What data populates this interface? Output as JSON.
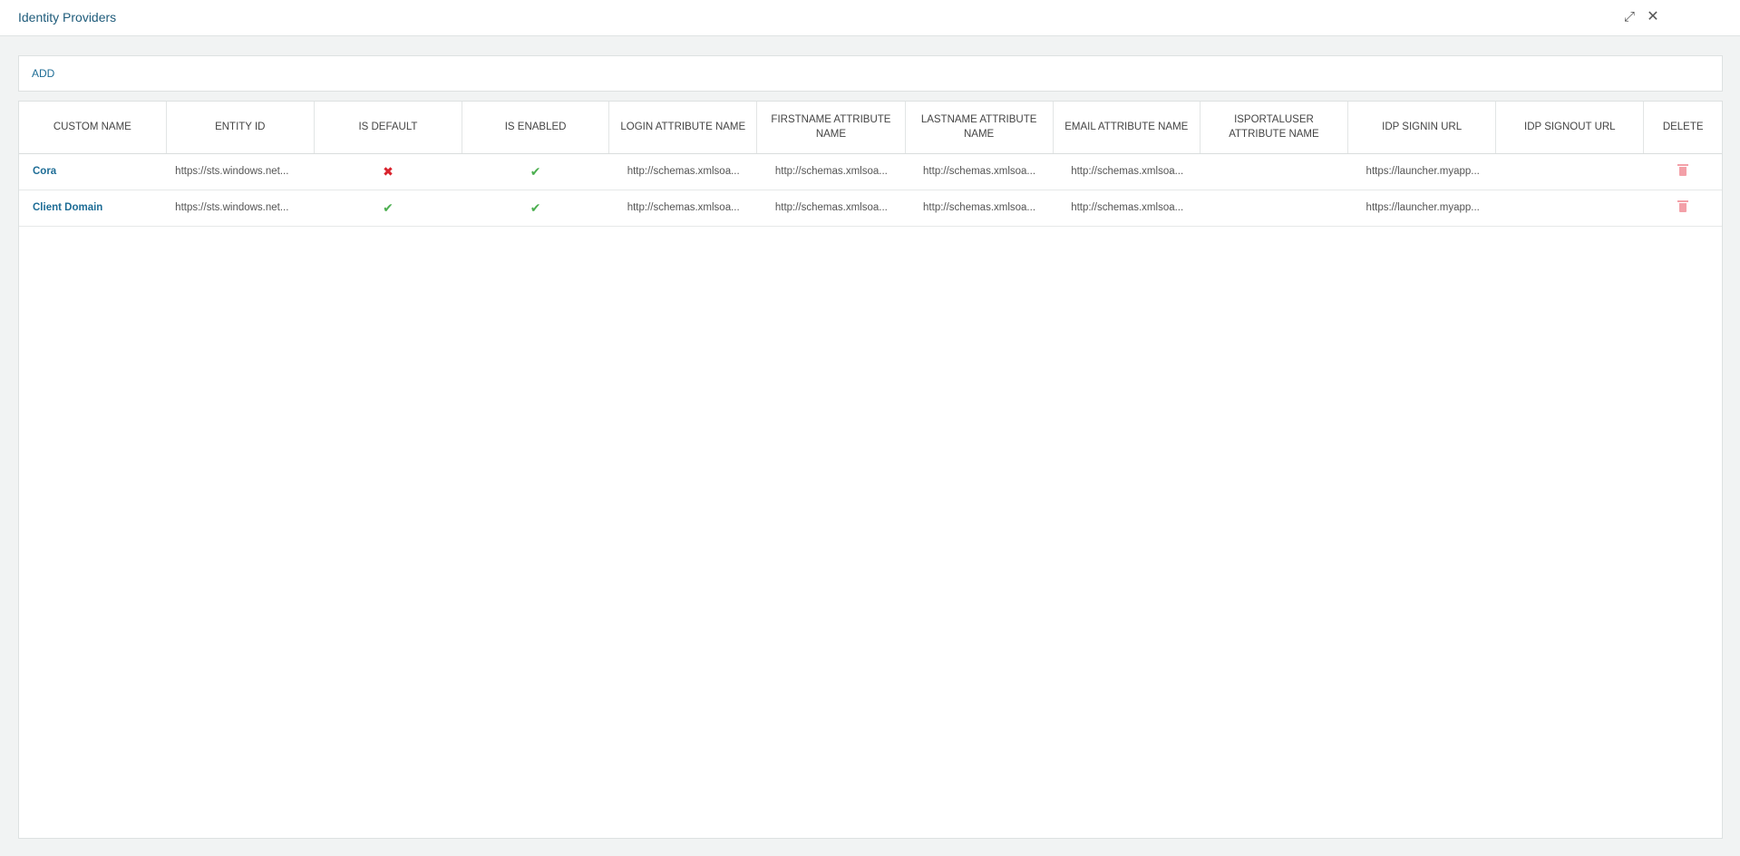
{
  "window": {
    "title": "Identity Providers",
    "minimize_icon": "⤢",
    "close_icon": "✕"
  },
  "toolbar": {
    "add_label": "ADD"
  },
  "table": {
    "columns": [
      "CUSTOM NAME",
      "ENTITY ID",
      "IS DEFAULT",
      "IS ENABLED",
      "LOGIN ATTRIBUTE NAME",
      "FIRSTNAME ATTRIBUTE NAME",
      "LASTNAME ATTRIBUTE NAME",
      "EMAIL ATTRIBUTE NAME",
      "ISPORTALUSER ATTRIBUTE NAME",
      "IDP SIGNIN URL",
      "IDP SIGNOUT URL",
      "DELETE"
    ],
    "rows": [
      {
        "custom_name": "Cora",
        "entity_id": "https://sts.windows.net...",
        "is_default": "cross-icon",
        "is_enabled": "check-icon",
        "login_attr": "http://schemas.xmlsoa...",
        "firstname_attr": "http://schemas.xmlsoa...",
        "lastname_attr": "http://schemas.xmlsoa...",
        "email_attr": "http://schemas.xmlsoa...",
        "isportaluser_attr": "",
        "signin_url": "https://launcher.myapp...",
        "signout_url": ""
      },
      {
        "custom_name": "Client Domain",
        "entity_id": "https://sts.windows.net...",
        "is_default": "check-icon",
        "is_enabled": "check-icon",
        "login_attr": "http://schemas.xmlsoa...",
        "firstname_attr": "http://schemas.xmlsoa...",
        "lastname_attr": "http://schemas.xmlsoa...",
        "email_attr": "http://schemas.xmlsoa...",
        "isportaluser_attr": "",
        "signin_url": "https://launcher.myapp...",
        "signout_url": ""
      }
    ]
  },
  "colors": {
    "link": "#1e6d96",
    "check": "#4caf50",
    "cross": "#d9232d",
    "trash": "#f3a0a8"
  }
}
